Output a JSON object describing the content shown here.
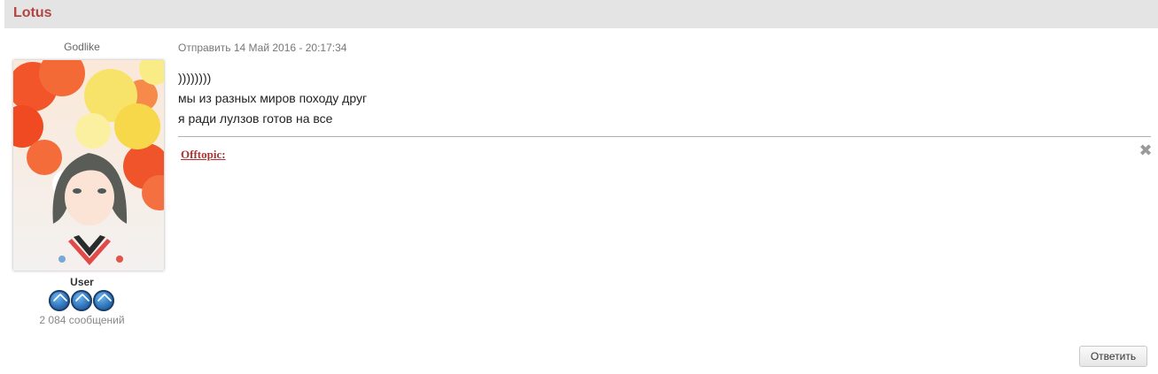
{
  "post": {
    "author": "Lotus",
    "rank_title": "Godlike",
    "group": "User",
    "post_count": "2 084 сообщений",
    "date": "Отправить 14 Май 2016 - 20:17:34",
    "lines": [
      "))))))))",
      "мы из разных миров походу друг",
      "я ради лулзов готов на все"
    ],
    "offtopic_label": "Offtopic:",
    "reply_label": "Ответить"
  },
  "badges": [
    "rank-badge-icon",
    "rank-badge-icon",
    "rank-badge-icon"
  ],
  "colors": {
    "author": "#b24444",
    "header_bg": "#e4e4e4",
    "offtopic": "#aa3333"
  }
}
